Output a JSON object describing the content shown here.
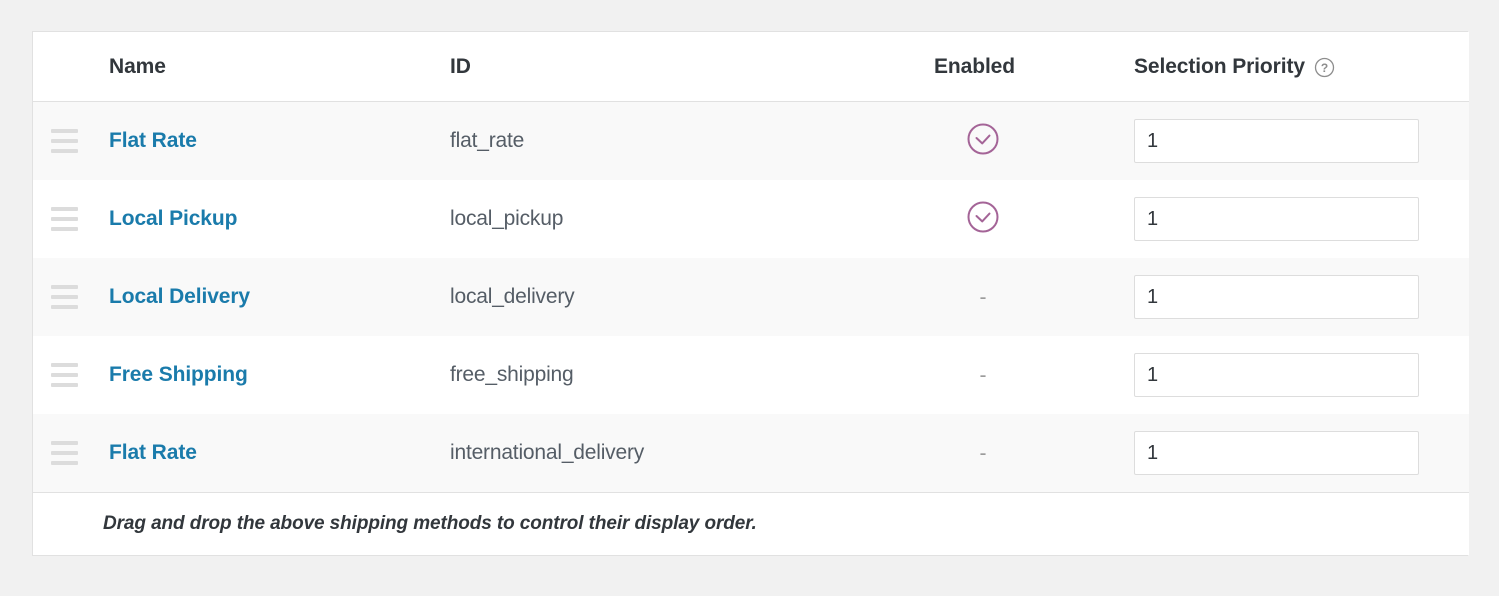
{
  "table": {
    "columns": {
      "handle": "",
      "name": "Name",
      "id": "ID",
      "enabled": "Enabled",
      "priority": "Selection Priority"
    },
    "priority_help_tooltip": "?",
    "enabled_true_symbol": "check-circle",
    "enabled_false_symbol": "-",
    "rows": [
      {
        "name": "Flat Rate",
        "id": "flat_rate",
        "enabled": true,
        "enabled_mark": "-",
        "priority": "1",
        "priority_placeholder": "1"
      },
      {
        "name": "Local Pickup",
        "id": "local_pickup",
        "enabled": true,
        "enabled_mark": "-",
        "priority": "1",
        "priority_placeholder": "1"
      },
      {
        "name": "Local Delivery",
        "id": "local_delivery",
        "enabled": false,
        "enabled_mark": "-",
        "priority": "1",
        "priority_placeholder": "1"
      },
      {
        "name": "Free Shipping",
        "id": "free_shipping",
        "enabled": false,
        "enabled_mark": "-",
        "priority": "1",
        "priority_placeholder": "1"
      },
      {
        "name": "Flat Rate",
        "id": "international_delivery",
        "enabled": false,
        "enabled_mark": "-",
        "priority": "1",
        "priority_placeholder": "1"
      }
    ],
    "footer_note": "Drag and drop the above shipping methods to control their display order."
  },
  "colors": {
    "page_background": "#f1f1f1",
    "card_background": "#ffffff",
    "row_alt_background": "#f9f9f9",
    "border": "#e1e1e1",
    "link": "#1a7bab",
    "heading_text": "#32373c",
    "muted_text": "#555d66",
    "enabled_check": "#a46497",
    "handle_bar": "#dcdcdc",
    "input_border": "#dddddd"
  }
}
